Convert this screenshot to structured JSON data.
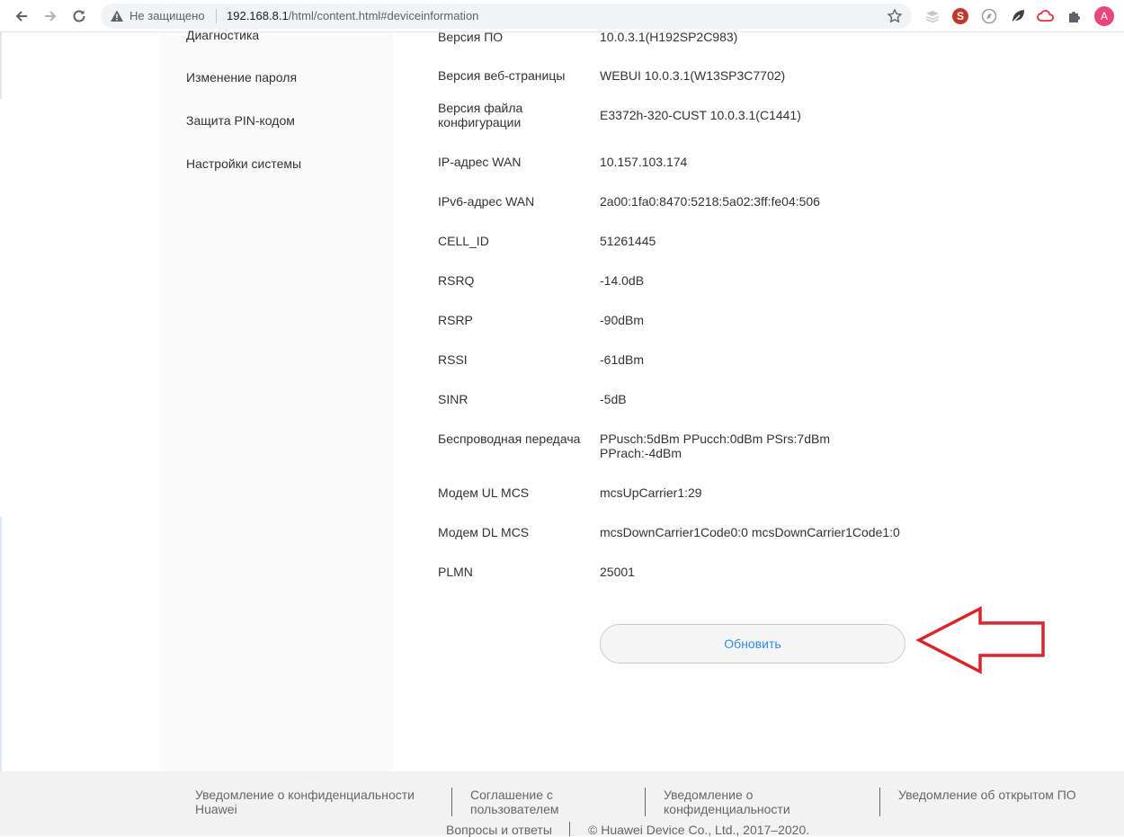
{
  "browser": {
    "security_label": "Не защищено",
    "url_host": "192.168.8.1",
    "url_path": "/html/content.html#deviceinformation",
    "avatar_letter": "A",
    "icons": [
      "back-icon",
      "forward-icon",
      "reload-icon",
      "warning-icon",
      "star-icon",
      "layers-icon",
      "seo-icon",
      "compass-icon",
      "leaf-icon",
      "cloud-icon",
      "puzzle-icon"
    ]
  },
  "sidebar": {
    "items": [
      {
        "label": "Диагностика"
      },
      {
        "label": "Изменение пароля"
      },
      {
        "label": "Защита PIN-кодом"
      },
      {
        "label": "Настройки системы"
      }
    ]
  },
  "device_info": {
    "rows": [
      {
        "label": "Версия ПО",
        "value": "10.0.3.1(H192SP2C983)"
      },
      {
        "label": "Версия веб-страницы",
        "value": "WEBUI 10.0.3.1(W13SP3C7702)"
      },
      {
        "label": "Версия файла конфигурации",
        "value": "E3372h-320-CUST 10.0.3.1(C1441)"
      },
      {
        "label": "IP-адрес WAN",
        "value": "10.157.103.174"
      },
      {
        "label": "IPv6-адрес WAN",
        "value": "2a00:1fa0:8470:5218:5a02:3ff:fe04:506"
      },
      {
        "label": "CELL_ID",
        "value": "51261445"
      },
      {
        "label": "RSRQ",
        "value": "-14.0dB"
      },
      {
        "label": "RSRP",
        "value": "-90dBm"
      },
      {
        "label": "RSSI",
        "value": "-61dBm"
      },
      {
        "label": "SINR",
        "value": "-5dB"
      },
      {
        "label": "Беспроводная передача",
        "value": "PPusch:5dBm PPucch:0dBm PSrs:7dBm PPrach:-4dBm"
      },
      {
        "label": "Модем UL MCS",
        "value": "mcsUpCarrier1:29"
      },
      {
        "label": "Модем DL MCS",
        "value": "mcsDownCarrier1Code0:0 mcsDownCarrier1Code1:0"
      },
      {
        "label": "PLMN",
        "value": "25001"
      }
    ],
    "refresh_label": "Обновить"
  },
  "annotation": {
    "arrow_color": "#d9262e"
  },
  "footer": {
    "privacy_huawei": "Уведомление о конфиденциальности Huawei",
    "user_agreement": "Соглашение с пользователем",
    "privacy_notice": "Уведомление о конфиденциальности",
    "open_source": "Уведомление об открытом ПО",
    "faq": "Вопросы и ответы",
    "copyright": "© Huawei Device Co., Ltd., 2017–2020."
  }
}
